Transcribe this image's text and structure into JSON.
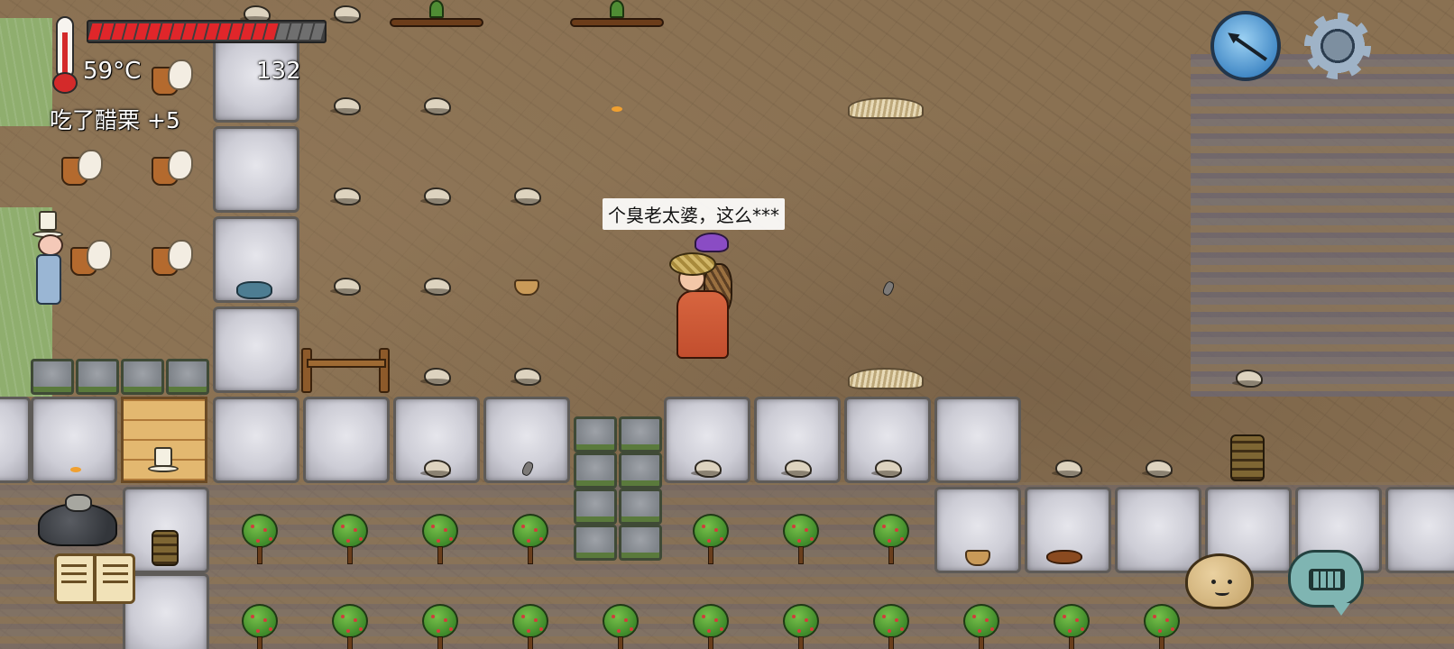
{
  "hud": {
    "temperature": "59°C",
    "yum_bonus": "132",
    "status_message": "吃了醋栗 +5",
    "food_pips_total": 20,
    "food_pips_filled": 16,
    "food_color": "#e0262a"
  },
  "speech_bubble": {
    "text": "个臭老太婆，这么***"
  },
  "icons": {
    "thermometer": "thermometer-icon",
    "compass": "compass-icon",
    "settings": "gear-icon",
    "tech_book": "book-icon",
    "emote": "potato-emote-icon",
    "chat": "keyboard-chat-icon"
  }
}
